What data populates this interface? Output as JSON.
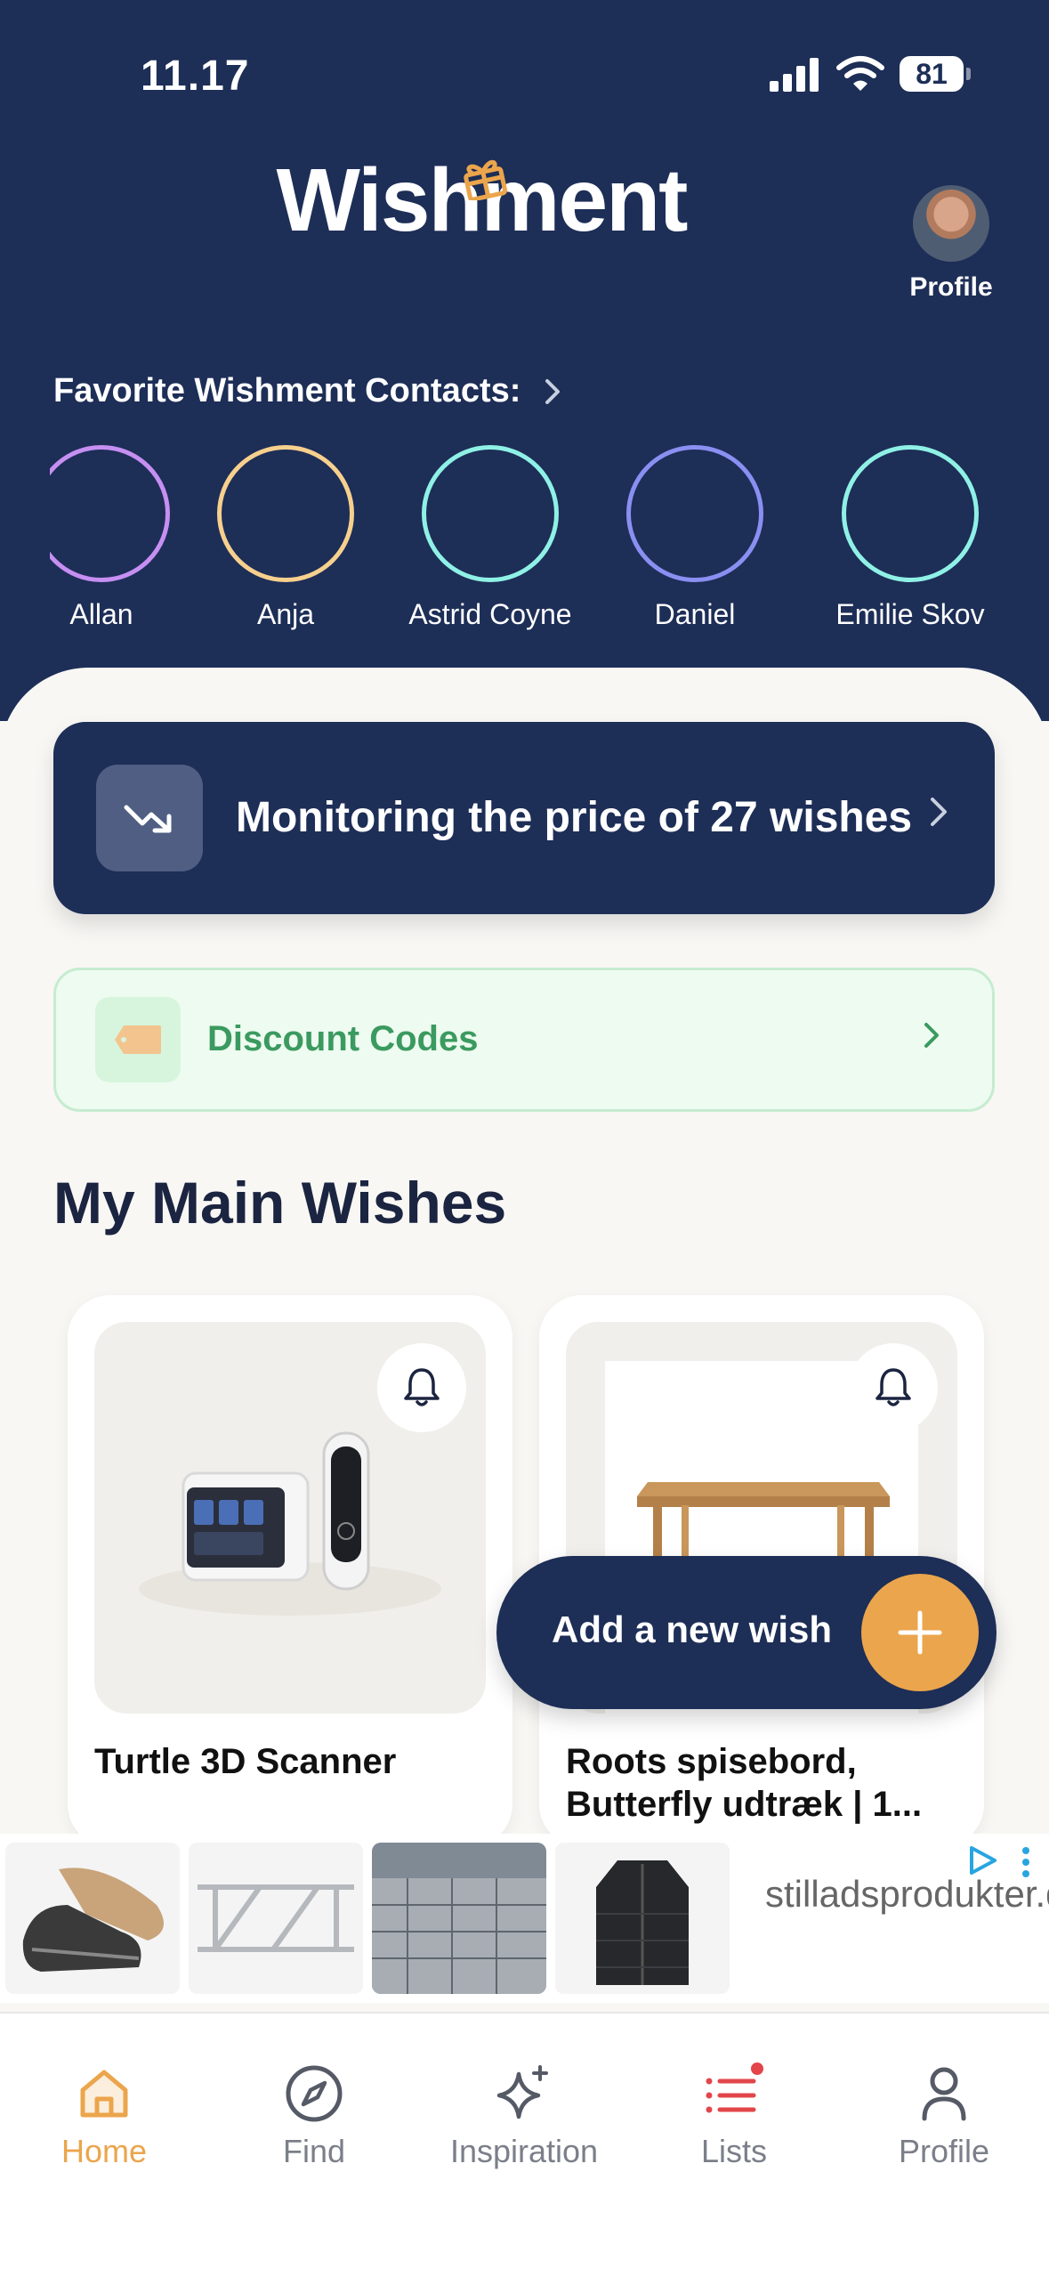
{
  "status_bar": {
    "time": "11.17",
    "battery": "81"
  },
  "header": {
    "app_title": "Wishment",
    "profile_label": "Profile"
  },
  "favorites": {
    "title": "Favorite Wishment Contacts:",
    "contacts": [
      {
        "name": "Allan",
        "ring_color": "#c68ff2"
      },
      {
        "name": "Anja",
        "ring_color": "#f7d08e"
      },
      {
        "name": "Astrid Coyne",
        "ring_color": "#8ff1e6"
      },
      {
        "name": "Daniel",
        "ring_color": "#8a8ff2"
      },
      {
        "name": "Emilie Skov",
        "ring_color": "#8ff1e6"
      }
    ]
  },
  "monitor": {
    "text": "Monitoring the price of 27 wishes"
  },
  "discount": {
    "label": "Discount Codes"
  },
  "main_wishes": {
    "title": "My Main Wishes",
    "items": [
      {
        "name": "Turtle 3D Scanner"
      },
      {
        "name": "Roots spisebord, Butterfly udtræk | 1..."
      }
    ]
  },
  "fab": {
    "label": "Add a new wish"
  },
  "ad": {
    "advertiser": "stilladsprodukter.dk"
  },
  "tabs": [
    {
      "label": "Home",
      "icon": "home-icon",
      "active": true
    },
    {
      "label": "Find",
      "icon": "compass-icon"
    },
    {
      "label": "Inspiration",
      "icon": "sparkle-icon"
    },
    {
      "label": "Lists",
      "icon": "list-icon"
    },
    {
      "label": "Profile",
      "icon": "person-icon"
    }
  ],
  "colors": {
    "header_bg": "#1d2e57",
    "accent": "#eba54c",
    "discount_text": "#3b9a5f"
  }
}
